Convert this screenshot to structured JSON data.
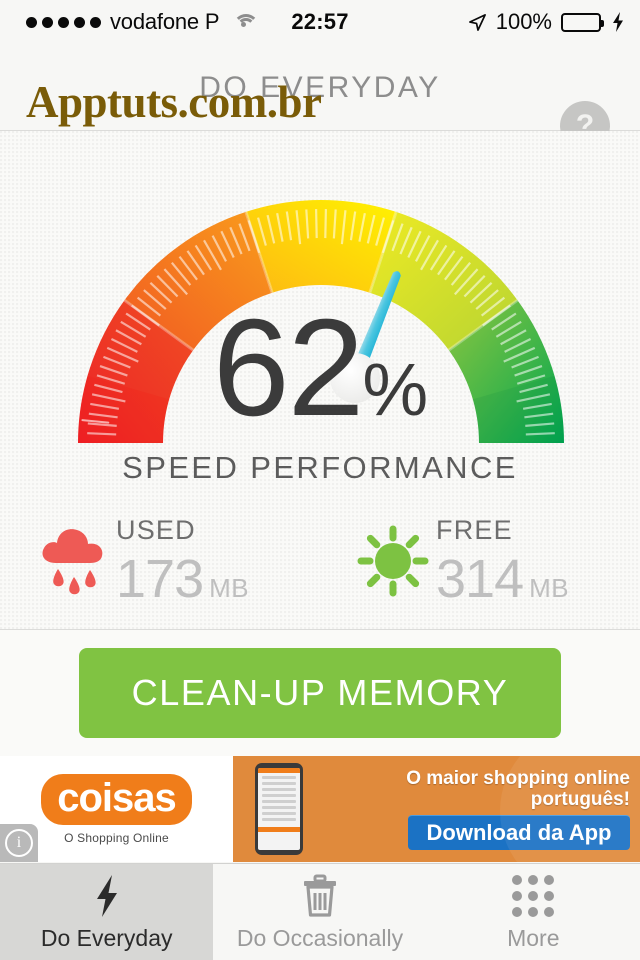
{
  "status_bar": {
    "signal_dots": 5,
    "carrier": "vodafone P",
    "wifi_icon": "wifi-icon",
    "time": "22:57",
    "location_icon": "location-arrow-icon",
    "battery_percent": "100%",
    "battery_level": 100,
    "charging_icon": "lightning-bolt-icon",
    "battery_color": "#4ddb6a"
  },
  "navbar": {
    "title": "DO EVERYDAY",
    "help_label": "?"
  },
  "watermark": {
    "text": "Apptuts.com.br",
    "color": "#7a5c08"
  },
  "gauge": {
    "value": 62,
    "value_text": "62",
    "percent_symbol": "%",
    "subtitle": "SPEED PERFORMANCE",
    "min": 0,
    "max": 100,
    "needle_color": "#35bcdc",
    "hub_color": "#f2f2f0",
    "colors": {
      "red": "#ec2227",
      "orange": "#f58220",
      "yellow": "#fff200",
      "light_green": "#b9d532",
      "green": "#1fae4d"
    }
  },
  "stats": [
    {
      "icon": "rain-cloud-icon",
      "icon_color": "#ee5a55",
      "label": "USED",
      "value": "173",
      "unit": "MB"
    },
    {
      "icon": "sun-icon",
      "icon_color": "#7dc242",
      "label": "FREE",
      "value": "314",
      "unit": "MB"
    }
  ],
  "clean_button": {
    "label": "CLEAN-UP MEMORY",
    "color": "#80c342"
  },
  "ad": {
    "brand": "coisas",
    "brand_tagline": "O Shopping Online",
    "headline_line1": "O maior shopping online",
    "headline_line2": "português!",
    "cta": "Download da App",
    "info_icon": "info-icon",
    "brand_color": "#f07d1a",
    "cta_color": "#1b72c4"
  },
  "tabbar": {
    "tabs": [
      {
        "icon": "lightning-bolt-icon",
        "label": "Do Everyday",
        "active": true
      },
      {
        "icon": "trash-icon",
        "label": "Do Occasionally",
        "active": false
      },
      {
        "icon": "grid-dots-icon",
        "label": "More",
        "active": false
      }
    ]
  }
}
